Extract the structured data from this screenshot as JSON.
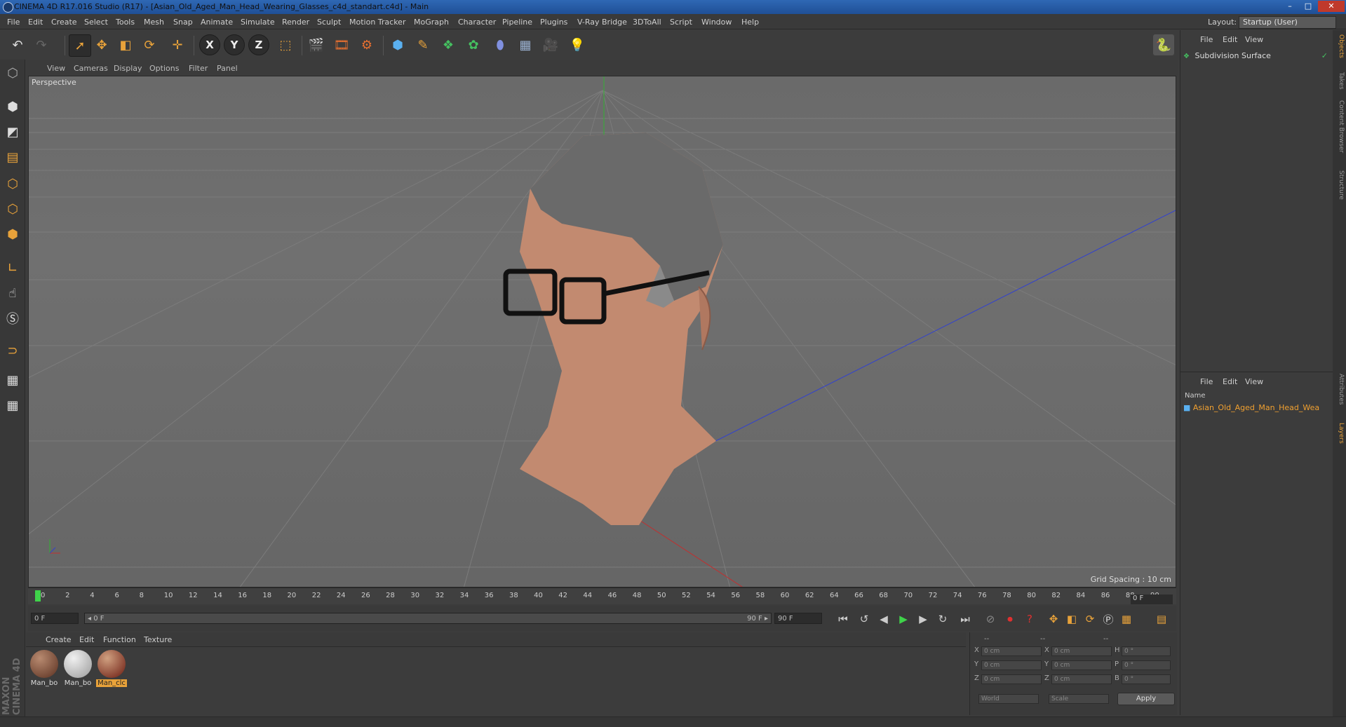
{
  "window": {
    "title": "CINEMA 4D R17.016 Studio (R17) - [Asian_Old_Aged_Man_Head_Wearing_Glasses_c4d_standart.c4d] - Main",
    "minimize": "–",
    "maximize": "□",
    "close": "✕"
  },
  "menubar": {
    "items": [
      "File",
      "Edit",
      "Create",
      "Select",
      "Tools",
      "Mesh",
      "Snap",
      "Animate",
      "Simulate",
      "Render",
      "Sculpt",
      "Motion Tracker",
      "MoGraph",
      "Character",
      "Pipeline",
      "Plugins",
      "V-Ray Bridge",
      "3DToAll",
      "Script",
      "Window",
      "Help"
    ],
    "layout_label": "Layout:",
    "layout_value": "Startup (User)"
  },
  "toolbar": {
    "axis_x": "X",
    "axis_y": "Y",
    "axis_z": "Z"
  },
  "viewport": {
    "menu": [
      "View",
      "Cameras",
      "Display",
      "Options",
      "Filter",
      "Panel"
    ],
    "camera_label": "Perspective",
    "grid_spacing": "Grid Spacing : 10 cm"
  },
  "timeline": {
    "ticks": [
      "0",
      "2",
      "4",
      "6",
      "8",
      "10",
      "12",
      "14",
      "16",
      "18",
      "20",
      "22",
      "24",
      "26",
      "28",
      "30",
      "32",
      "34",
      "36",
      "38",
      "40",
      "42",
      "44",
      "46",
      "48",
      "50",
      "52",
      "54",
      "56",
      "58",
      "60",
      "62",
      "64",
      "66",
      "68",
      "70",
      "72",
      "74",
      "76",
      "78",
      "80",
      "82",
      "84",
      "86",
      "88",
      "90"
    ],
    "current_frame": "0 F"
  },
  "transport": {
    "start_field": "0 F",
    "range_start": "◂ 0 F",
    "range_end": "90 F ▸",
    "end_field": "90 F"
  },
  "materials": {
    "menu": [
      "Create",
      "Edit",
      "Function",
      "Texture"
    ],
    "items": [
      {
        "label": "Man_bo",
        "color": "#7a4a3a"
      },
      {
        "label": "Man_bo",
        "color": "#cfcfcf"
      },
      {
        "label": "Man_clc",
        "color": "#8a2a1a"
      }
    ]
  },
  "coords": {
    "header": [
      "--",
      "--",
      "--"
    ],
    "rows": [
      {
        "a1": "X",
        "v1": "0 cm",
        "a2": "X",
        "v2": "0 cm",
        "a3": "H",
        "v3": "0 °"
      },
      {
        "a1": "Y",
        "v1": "0 cm",
        "a2": "Y",
        "v2": "0 cm",
        "a3": "P",
        "v3": "0 °"
      },
      {
        "a1": "Z",
        "v1": "0 cm",
        "a2": "Z",
        "v2": "0 cm",
        "a3": "B",
        "v3": "0 °"
      }
    ],
    "mode_world": "World",
    "mode_scale": "Scale",
    "apply": "Apply"
  },
  "object_panel": {
    "menu": [
      "File",
      "Edit",
      "View"
    ],
    "objects": [
      "Subdivision Surface"
    ]
  },
  "layer_panel": {
    "menu": [
      "File",
      "Edit",
      "View"
    ],
    "column_name": "Name",
    "items": [
      "Asian_Old_Aged_Man_Head_Wea"
    ]
  },
  "right_tabs": [
    "Objects",
    "Takes",
    "Content Browser",
    "Structure",
    "Attributes",
    "Layers"
  ],
  "branding": "MAXON CINEMA 4D",
  "colors": {
    "accent_orange": "#e8a23a",
    "highlight_text": "#f0a030",
    "playhead": "#3fd34a"
  }
}
